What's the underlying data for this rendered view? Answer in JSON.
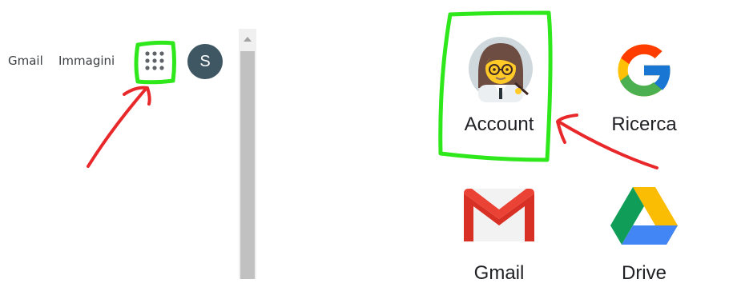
{
  "topbar": {
    "links": [
      {
        "label": "Gmail"
      },
      {
        "label": "Immagini"
      }
    ],
    "apps_button_icon": "apps-grid-icon",
    "avatar_initial": "S"
  },
  "apps_panel": {
    "items": [
      {
        "label": "Account",
        "icon": "account-avatar-icon"
      },
      {
        "label": "Ricerca",
        "icon": "google-g-icon"
      },
      {
        "label": "Gmail",
        "icon": "gmail-icon"
      },
      {
        "label": "Drive",
        "icon": "drive-icon"
      }
    ]
  },
  "annotations": {
    "highlight_color": "#2ee81b",
    "arrow_color": "#e8282a"
  }
}
